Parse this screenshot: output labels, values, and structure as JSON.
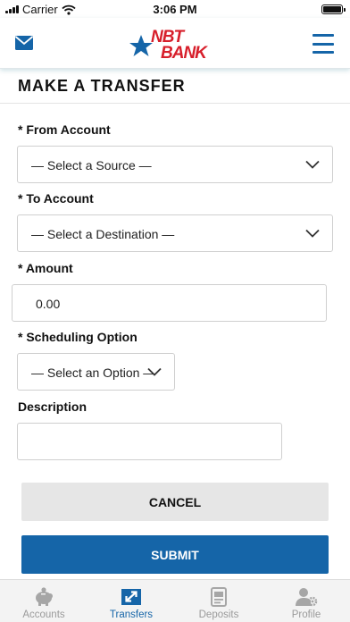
{
  "status_bar": {
    "carrier": "Carrier",
    "time": "3:06 PM"
  },
  "header": {
    "logo_text_top": "NBT",
    "logo_text_bottom": "BANK",
    "brand_color": "#1565a8",
    "logo_red": "#d71f2b"
  },
  "page": {
    "title": "MAKE A TRANSFER"
  },
  "form": {
    "from_label": "* From Account",
    "from_value": "— Select a Source —",
    "to_label": "* To Account",
    "to_value": "— Select a Destination —",
    "amount_label": "* Amount",
    "amount_value": "0.00",
    "schedule_label": "* Scheduling Option",
    "schedule_value": "— Select an Option —",
    "description_label": "Description",
    "description_value": ""
  },
  "actions": {
    "cancel": "CANCEL",
    "submit": "SUBMIT"
  },
  "tabs": [
    {
      "label": "Accounts",
      "icon": "piggy-bank-icon",
      "active": false
    },
    {
      "label": "Transfers",
      "icon": "transfer-arrows-icon",
      "active": true
    },
    {
      "label": "Deposits",
      "icon": "check-deposit-icon",
      "active": false
    },
    {
      "label": "Profile",
      "icon": "profile-gear-icon",
      "active": false
    }
  ]
}
